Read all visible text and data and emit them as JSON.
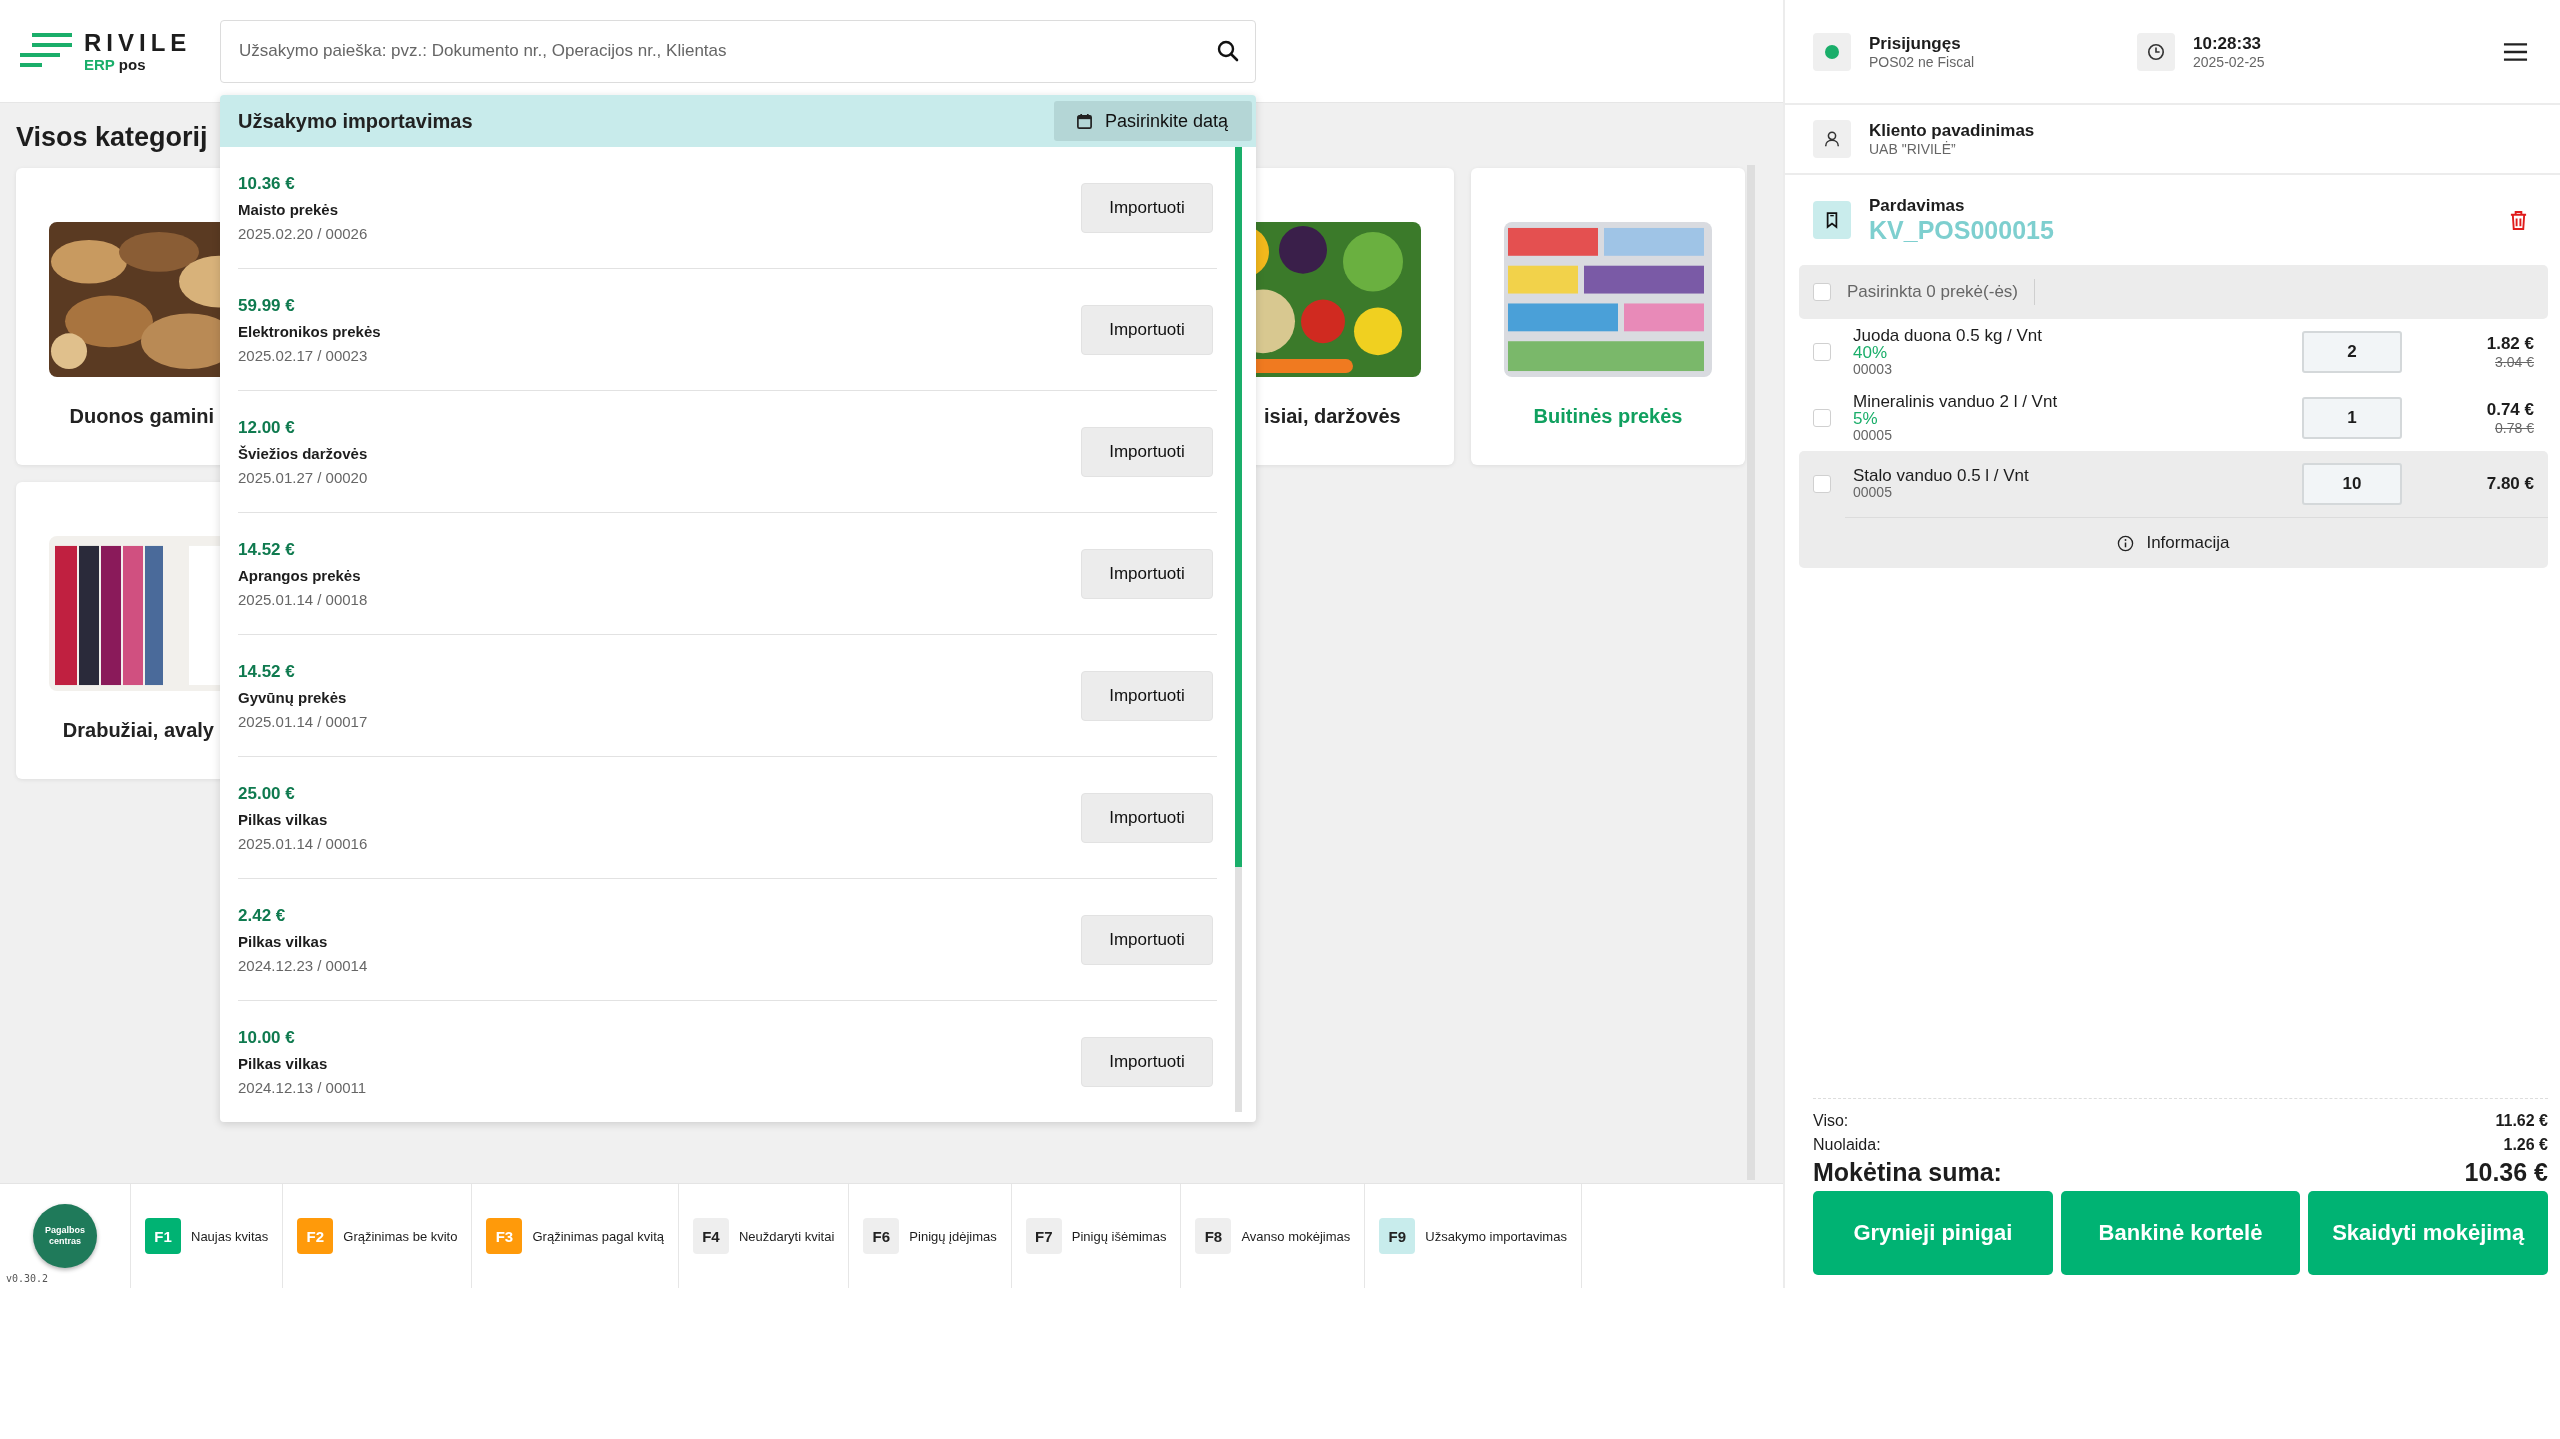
{
  "logo": {
    "brand": "RIVILE",
    "product": "ERP",
    "suffix": "pos"
  },
  "search": {
    "placeholder": "Užsakymo paieška: pvz.: Dokumento nr., Operacijos nr., Klientas"
  },
  "heading": "Visos kategorij",
  "categories": [
    {
      "label": "Duonos gamini",
      "selected": false
    },
    {
      "label": "isiai, daržovės",
      "selected": false
    },
    {
      "label": "Buitinės prekės",
      "selected": true
    },
    {
      "label": "Drabužiai, avaly",
      "selected": false
    }
  ],
  "import_panel": {
    "title": "Užsakymo importavimas",
    "date_button": "Pasirinkite datą",
    "orders": [
      {
        "amount": "10.36 €",
        "name": "Maisto prekės",
        "meta": "2025.02.20 / 00026",
        "action": "Importuoti"
      },
      {
        "amount": "59.99 €",
        "name": "Elektronikos prekės",
        "meta": "2025.02.17 / 00023",
        "action": "Importuoti"
      },
      {
        "amount": "12.00 €",
        "name": "Šviežios daržovės",
        "meta": "2025.01.27 / 00020",
        "action": "Importuoti"
      },
      {
        "amount": "14.52 €",
        "name": "Aprangos prekės",
        "meta": "2025.01.14 / 00018",
        "action": "Importuoti"
      },
      {
        "amount": "14.52 €",
        "name": "Gyvūnų prekės",
        "meta": "2025.01.14 / 00017",
        "action": "Importuoti"
      },
      {
        "amount": "25.00 €",
        "name": "Pilkas vilkas",
        "meta": "2025.01.14 / 00016",
        "action": "Importuoti"
      },
      {
        "amount": "2.42 €",
        "name": "Pilkas vilkas",
        "meta": "2024.12.23 / 00014",
        "action": "Importuoti"
      },
      {
        "amount": "10.00 €",
        "name": "Pilkas vilkas",
        "meta": "2024.12.13 / 00011",
        "action": "Importuoti"
      }
    ]
  },
  "footer": {
    "help": "Pagalbos centras",
    "version": "v0.30.2",
    "keys": [
      {
        "key": "F1",
        "label": "Naujas kvitas",
        "color": "#00b373"
      },
      {
        "key": "F2",
        "label": "Grąžinimas be kvito",
        "color": "#ff9a0a"
      },
      {
        "key": "F3",
        "label": "Grąžinimas pagal kvitą",
        "color": "#ff9a0a"
      },
      {
        "key": "F4",
        "label": "Neuždaryti kvitai",
        "color": "#eeeeee"
      },
      {
        "key": "F6",
        "label": "Pinigų įdėjimas",
        "color": "#eeeeee"
      },
      {
        "key": "F7",
        "label": "Pinigų išėmimas",
        "color": "#eeeeee"
      },
      {
        "key": "F8",
        "label": "Avanso mokėjimas",
        "color": "#eeeeee"
      },
      {
        "key": "F9",
        "label": "Užsakymo importavimas",
        "color": "#c8ecec"
      }
    ]
  },
  "status": {
    "connection": {
      "title": "Prisijungęs",
      "subtitle": "POS02 ne Fiscal",
      "online": true
    },
    "clock": {
      "time": "10:28:33",
      "date": "2025-02-25"
    }
  },
  "client": {
    "title": "Kliento pavadinimas",
    "name": "UAB \"RIVILĖ”"
  },
  "sale": {
    "title": "Pardavimas",
    "number": "KV_POS000015"
  },
  "cart": {
    "select_all": {
      "label": "Pasirinkta 0 prekė(-ės)",
      "checked": false
    },
    "items": [
      {
        "name": "Juoda duona 0.5 kg / Vnt",
        "discount": "40%",
        "code": "00003",
        "quantity": "2",
        "price": "1.82 €",
        "old_price": "3.04 €",
        "checked": false,
        "expanded": false
      },
      {
        "name": "Mineralinis vanduo 2 l / Vnt",
        "discount": "5%",
        "code": "00005",
        "quantity": "1",
        "price": "0.74 €",
        "old_price": "0.78 €",
        "checked": false,
        "expanded": false
      },
      {
        "name": "Stalo vanduo 0.5 l / Vnt",
        "code": "00005",
        "quantity": "10",
        "price": "7.80 €",
        "checked": false,
        "expanded": true,
        "info": "Informacija"
      }
    ]
  },
  "totals": {
    "subtotal_label": "Viso:",
    "subtotal": "11.62 €",
    "discount_label": "Nuolaida:",
    "discount": "1.26 €",
    "due_label": "Mokėtina suma:",
    "due": "10.36 €"
  },
  "payments": [
    "Grynieji pinigai",
    "Bankinė kortelė",
    "Skaidyti mokėjimą"
  ]
}
